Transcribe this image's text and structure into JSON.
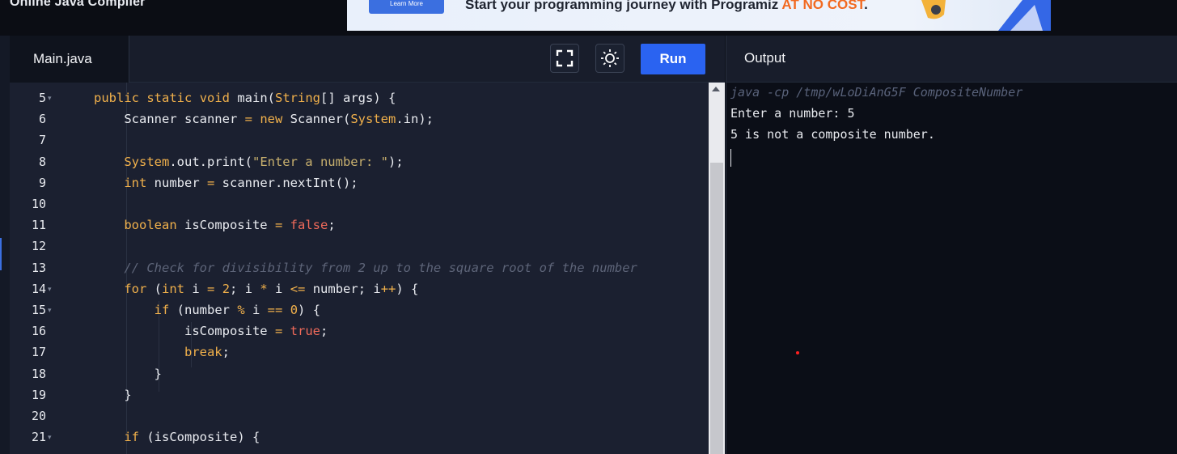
{
  "app": {
    "title": "Online Java Compiler"
  },
  "banner": {
    "button_label": "Learn More",
    "text_main": "Start your programming journey with Programiz ",
    "text_highlight": "AT NO COST",
    "text_end": "."
  },
  "editor": {
    "tab_label": "Main.java",
    "fullscreen_icon": "fullscreen-icon",
    "theme_icon": "sun-icon",
    "run_label": "Run",
    "lines": [
      {
        "num": "5",
        "fold": true,
        "code": "    public static void main(String[] args) {"
      },
      {
        "num": "6",
        "fold": false,
        "code": "        Scanner scanner = new Scanner(System.in);"
      },
      {
        "num": "7",
        "fold": false,
        "code": ""
      },
      {
        "num": "8",
        "fold": false,
        "code": "        System.out.print(\"Enter a number: \");"
      },
      {
        "num": "9",
        "fold": false,
        "code": "        int number = scanner.nextInt();"
      },
      {
        "num": "10",
        "fold": false,
        "code": ""
      },
      {
        "num": "11",
        "fold": false,
        "code": "        boolean isComposite = false;"
      },
      {
        "num": "12",
        "fold": false,
        "code": ""
      },
      {
        "num": "13",
        "fold": false,
        "code": "        // Check for divisibility from 2 up to the square root of the number"
      },
      {
        "num": "14",
        "fold": true,
        "code": "        for (int i = 2; i * i <= number; i++) {"
      },
      {
        "num": "15",
        "fold": true,
        "code": "            if (number % i == 0) {"
      },
      {
        "num": "16",
        "fold": false,
        "code": "                isComposite = true;"
      },
      {
        "num": "17",
        "fold": false,
        "code": "                break;"
      },
      {
        "num": "18",
        "fold": false,
        "code": "            }"
      },
      {
        "num": "19",
        "fold": false,
        "code": "        }"
      },
      {
        "num": "20",
        "fold": false,
        "code": ""
      },
      {
        "num": "21",
        "fold": true,
        "code": "        if (isComposite) {"
      }
    ]
  },
  "output": {
    "title": "Output",
    "command": "java -cp /tmp/wLoDiAnG5F CompositeNumber",
    "lines": [
      "Enter a number: 5",
      "5 is not a composite number."
    ]
  },
  "colors": {
    "run_button": "#2a63f1",
    "keyword": "#f0b04b",
    "literal": "#f06a5a",
    "comment": "#5d6478"
  }
}
